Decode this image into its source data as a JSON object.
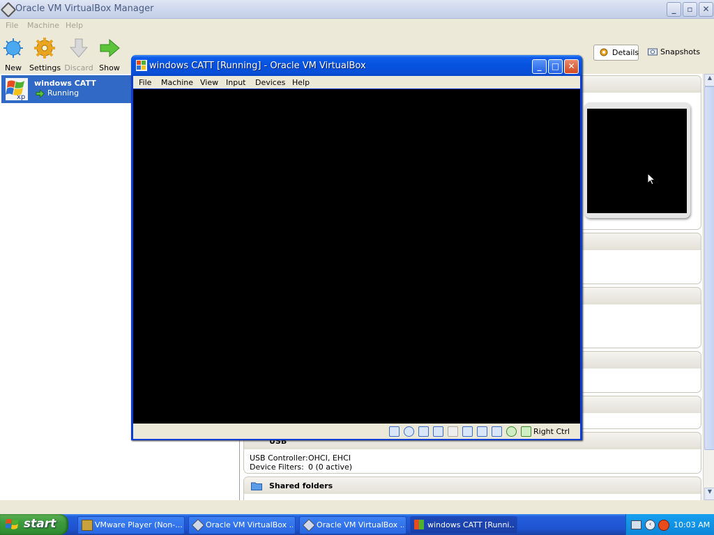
{
  "manager": {
    "title": "Oracle VM VirtualBox Manager",
    "menu": [
      "File",
      "Machine",
      "Help"
    ],
    "toolbar": {
      "new": "New",
      "settings": "Settings",
      "discard": "Discard",
      "show": "Show",
      "details": "Details",
      "snapshots": "Snapshots"
    },
    "vm": {
      "name": "windows CATT",
      "state": "Running"
    },
    "details": {
      "usb": {
        "title": "USB",
        "controller_label": "USB Controller:",
        "controller_value": "OHCI, EHCI",
        "filters_label": "Device Filters:",
        "filters_value": "0 (0 active)"
      },
      "shared_folders": {
        "title": "Shared folders"
      }
    }
  },
  "vm_window": {
    "title": "windows CATT [Running] - Oracle VM VirtualBox",
    "menu": [
      "File",
      "Machine",
      "View",
      "Input",
      "Devices",
      "Help"
    ],
    "host_key": "Right Ctrl"
  },
  "taskbar": {
    "start": "start",
    "tasks": [
      "VMware Player (Non-...",
      "Oracle VM VirtualBox ...",
      "Oracle VM VirtualBox ...",
      "windows CATT [Runni..."
    ],
    "clock": "10:03 AM"
  },
  "colors": {
    "selection": "#3169c6",
    "xp_blue": "#0552e0",
    "start_green": "#3c9a3c"
  }
}
